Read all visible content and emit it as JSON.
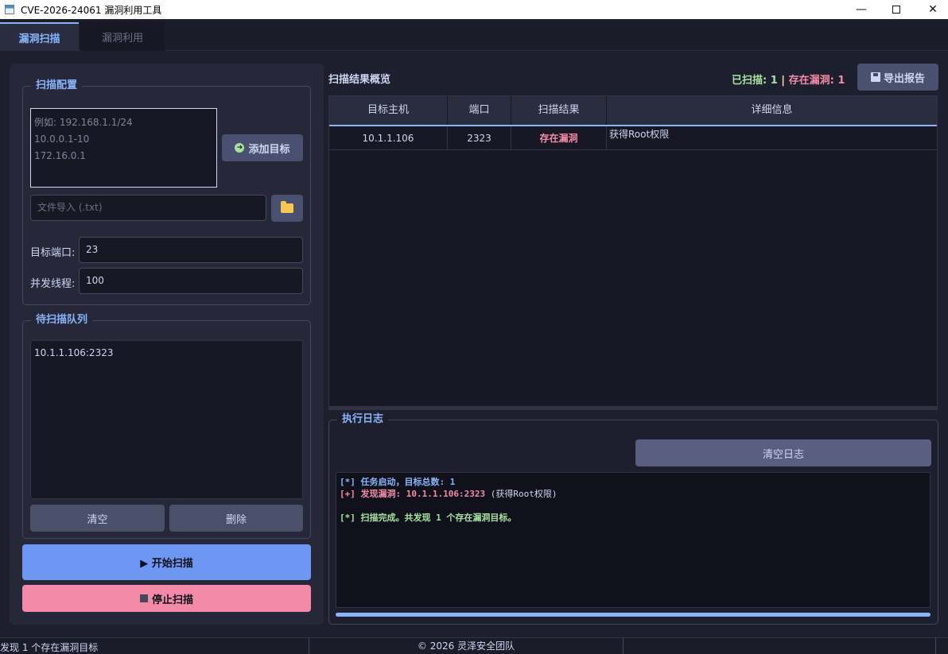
{
  "window": {
    "title": "CVE-2026-24061 漏洞利用工具",
    "minimize_glyph": "—",
    "close_glyph": "✕"
  },
  "tabs": [
    {
      "label": "漏洞扫描",
      "active": true
    },
    {
      "label": "漏洞利用",
      "active": false
    }
  ],
  "scan_config": {
    "title": "扫描配置",
    "targets_placeholder": "例如: 192.168.1.1/24\n10.0.0.1-10\n172.16.0.1",
    "add_target_label": "添加目标",
    "add_target_icon": "arrow-right-icon",
    "file_import_placeholder": "文件导入 (.txt)",
    "folder_icon": "folder-icon",
    "port_label": "目标端口:",
    "port_value": "23",
    "threads_label": "并发线程:",
    "threads_value": "100"
  },
  "queue": {
    "title": "待扫描队列",
    "items": [
      "10.1.1.106:2323"
    ],
    "clear_label": "清空",
    "delete_label": "删除"
  },
  "actions": {
    "start_label": "▶ 开始扫描",
    "stop_label": "停止扫描",
    "start_color": "#6e97f3",
    "stop_color": "#f38ba8"
  },
  "results": {
    "title": "扫描结果概览",
    "status_scanned": "已扫描: 1",
    "status_separator": " | ",
    "status_vuln": "存在漏洞: 1",
    "export_label": "导出报告",
    "export_icon": "floppy-disk-icon",
    "columns": [
      "目标主机",
      "端口",
      "扫描结果",
      "详细信息"
    ],
    "rows": [
      {
        "host": "10.1.1.106",
        "port": "2323",
        "result": "存在漏洞",
        "detail": "获得Root权限"
      }
    ]
  },
  "log": {
    "title": "执行日志",
    "clear_label": "清空日志",
    "lines": [
      {
        "type": "info",
        "text": "[*] 任务启动，目标总数: 1"
      },
      {
        "type": "found",
        "text": "[+] 发现漏洞: 10.1.1.106:2323",
        "note": " (获得Root权限)"
      },
      {
        "type": "blank",
        "text": ""
      },
      {
        "type": "done",
        "text": "[*] 扫描完成。共发现 1 个存在漏洞目标。"
      }
    ],
    "progress": 1.0
  },
  "statusbar": {
    "left": "发现 1 个存在漏洞目标",
    "center": "© 2026 灵泽安全团队"
  },
  "colors": {
    "accent": "#89b4fa",
    "success": "#a6e3a1",
    "danger": "#f38ba8",
    "background": "#1e1f2e"
  }
}
